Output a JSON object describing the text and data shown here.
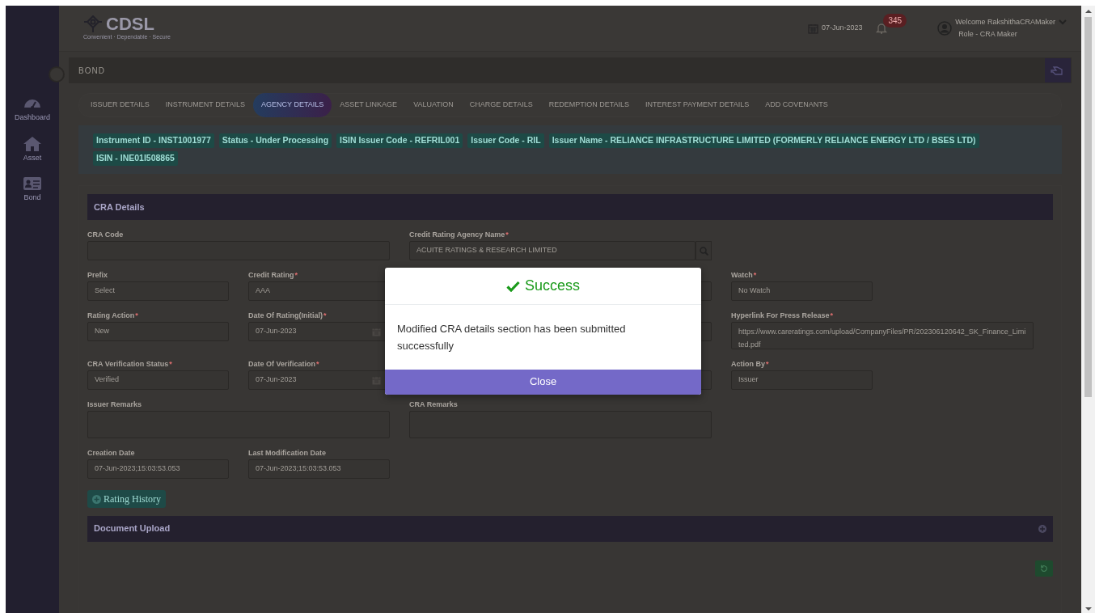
{
  "header": {
    "logo": "CDSL",
    "tagline": "Convenient · Dependable · Secure",
    "date": "07-Jun-2023",
    "notification_count": "345",
    "welcome": "Welcome RakshithaCRAMaker",
    "role": "Role - CRA Maker"
  },
  "sidebar": {
    "items": [
      {
        "label": "Dashboard",
        "kind": "gauge"
      },
      {
        "label": "Asset",
        "kind": "house"
      },
      {
        "label": "Bond",
        "kind": "card"
      }
    ]
  },
  "breadcrumb": "BOND",
  "tabs": [
    {
      "label": "ISSUER DETAILS",
      "selected": false
    },
    {
      "label": "INSTRUMENT DETAILS",
      "selected": false
    },
    {
      "label": "AGENCY DETAILS",
      "selected": true
    },
    {
      "label": "ASSET LINKAGE",
      "selected": false
    },
    {
      "label": "VALUATION",
      "selected": false
    },
    {
      "label": "CHARGE DETAILS",
      "selected": false
    },
    {
      "label": "REDEMPTION DETAILS",
      "selected": false
    },
    {
      "label": "INTEREST PAYMENT DETAILS",
      "selected": false
    },
    {
      "label": "ADD COVENANTS",
      "selected": false
    }
  ],
  "info_badges": [
    "Instrument ID - INST1001977",
    "Status - Under Processing",
    "ISIN Issuer Code - REFRIL001",
    "Issuer Code - RIL",
    "Issuer Name - RELIANCE INFRASTRUCTURE LIMITED (FORMERLY RELIANCE ENERGY LTD / BSES LTD)",
    "ISIN - INE01I508865"
  ],
  "cra_section": {
    "title": "CRA Details",
    "rows": [
      [
        {
          "kind": "wide",
          "label": "CRA Code"
        },
        {
          "kind": "search",
          "label": "Credit Rating Agency Name",
          "mark": "*",
          "value": "ACUITE RATINGS & RESEARCH LIMITED"
        }
      ],
      [
        {
          "kind": "text",
          "label": "Prefix",
          "value": "Select"
        },
        {
          "kind": "text",
          "label": "Credit Rating",
          "mark": "*",
          "value": "AAA"
        },
        {
          "kind": "covered"
        },
        {
          "kind": "covered"
        },
        {
          "kind": "text",
          "label": "Watch",
          "mark": "*",
          "value": "No Watch"
        }
      ],
      [
        {
          "kind": "text",
          "label": "Rating Action",
          "mark": "*",
          "value": "New"
        },
        {
          "kind": "date",
          "label": "Date Of Rating(Initial)",
          "mark": "*",
          "value": "07-Jun-2023"
        },
        {
          "kind": "covered"
        },
        {
          "kind": "covered"
        },
        {
          "kind": "textarea_wide",
          "label": "Hyperlink For Press Release",
          "mark": "*",
          "value": "https://www.careratings.com/upload/CompanyFiles/PR/202306120642_SK_Finance_Limited.pdf"
        }
      ],
      [
        {
          "kind": "text",
          "label": "CRA Verification Status",
          "mark": "*",
          "value": "Verified"
        },
        {
          "kind": "date",
          "label": "Date Of Verification",
          "mark": "*",
          "value": "07-Jun-2023"
        },
        {
          "kind": "covered"
        },
        {
          "kind": "covered"
        },
        {
          "kind": "text",
          "label": "Action By",
          "mark": "*",
          "value": "Issuer"
        }
      ],
      [
        {
          "kind": "textarea_wide",
          "label": "Issuer Remarks"
        },
        {
          "kind": "textarea_wide",
          "label": "CRA Remarks"
        }
      ],
      [
        {
          "kind": "text",
          "label": "Creation Date",
          "value": "07-Jun-2023;15:03:53.053"
        },
        {
          "kind": "text",
          "label": "Last Modification Date",
          "value": "07-Jun-2023;15:03:53.053"
        }
      ]
    ],
    "history_button": "Rating History"
  },
  "document_section": {
    "title": "Document Upload"
  },
  "modal": {
    "title": "Success",
    "message": "Modified CRA details section has been submitted successfully",
    "button": "Close"
  }
}
